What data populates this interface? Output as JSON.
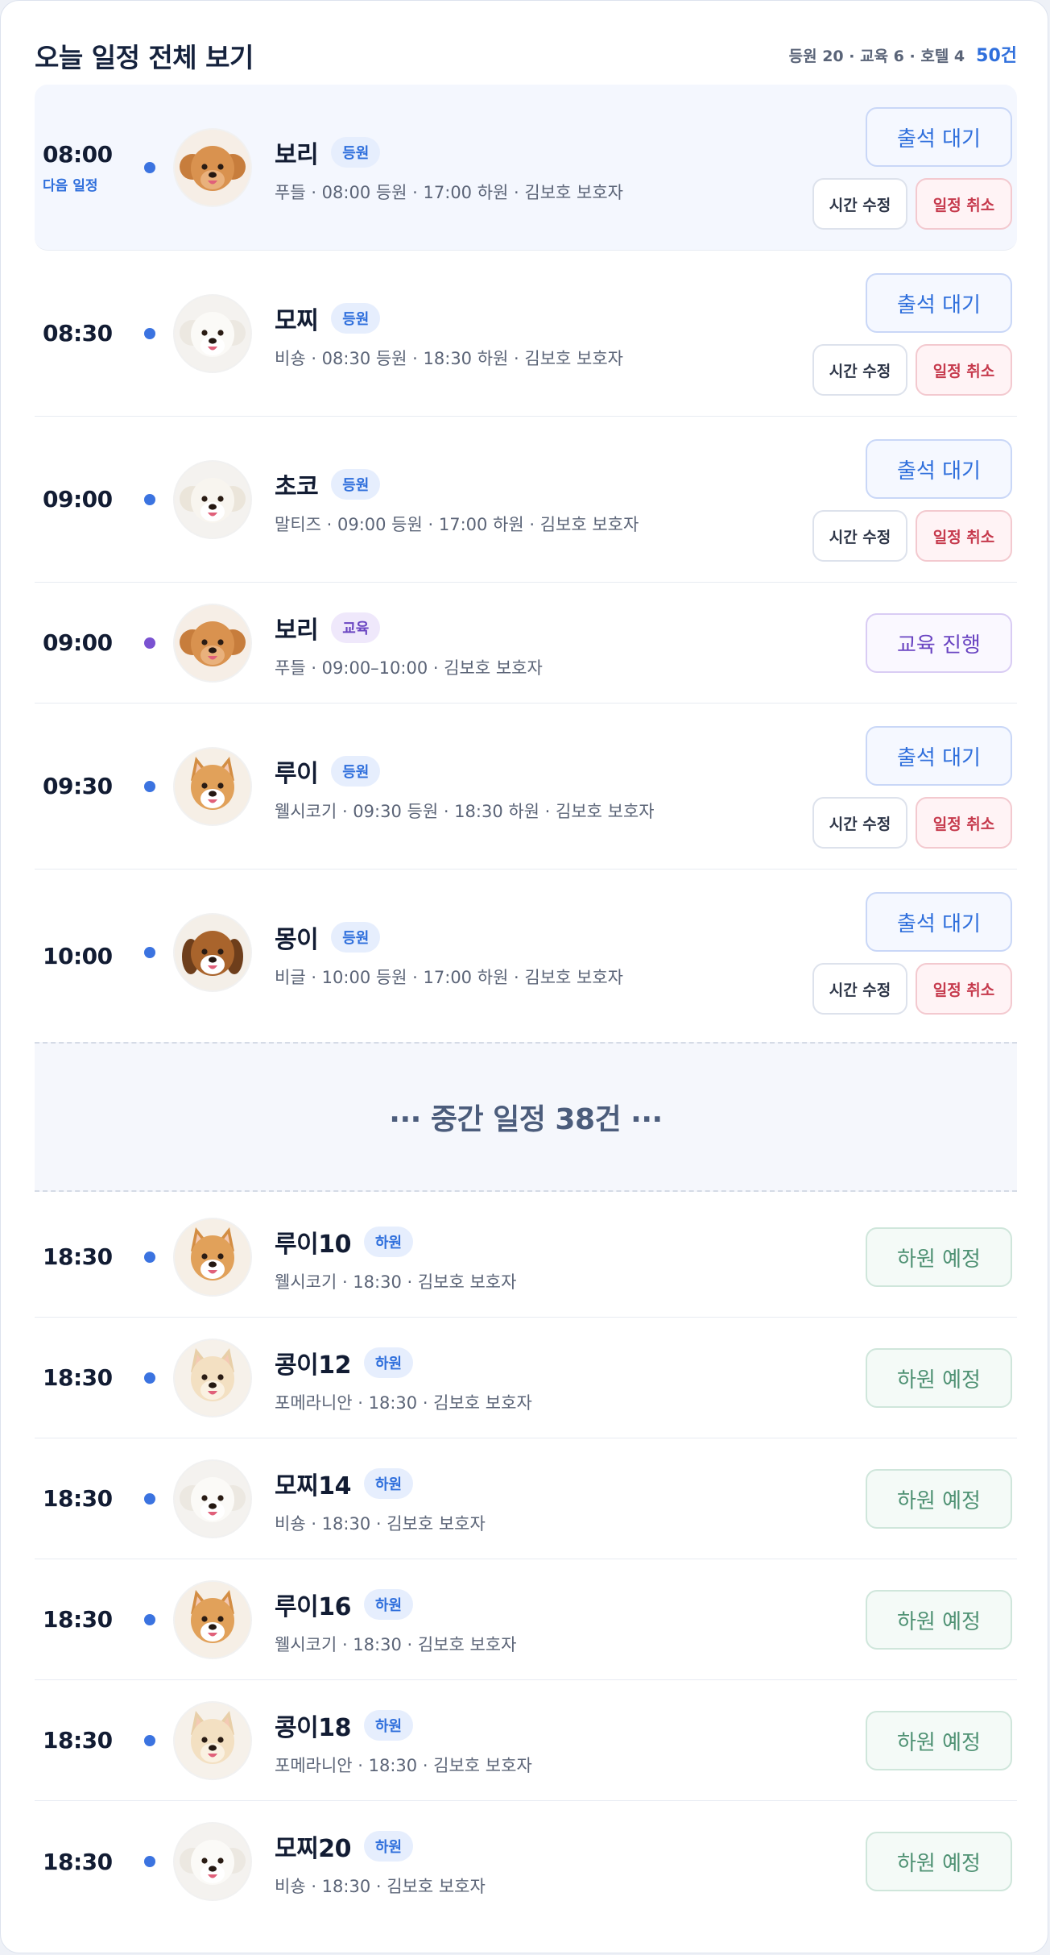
{
  "header": {
    "title": "오늘 일정 전체 보기",
    "summary": "등원 20 · 교육 6 · 호텔 4",
    "total": "50건"
  },
  "next_label": "다음 일정",
  "actions": {
    "edit_time": "시간 수정",
    "cancel": "일정 취소"
  },
  "rows_top": [
    {
      "time": "08:00",
      "name": "보리",
      "badge": "등원",
      "meta": "푸들 · 08:00 등원 · 17:00 하원 · 김보호 보호자",
      "action": "출석 대기",
      "breed": "poodle"
    },
    {
      "time": "08:30",
      "name": "모찌",
      "badge": "등원",
      "meta": "비숑 · 08:30 등원 · 18:30 하원 · 김보호 보호자",
      "action": "출석 대기",
      "breed": "bichon"
    },
    {
      "time": "09:00",
      "name": "초코",
      "badge": "등원",
      "meta": "말티즈 · 09:00 등원 · 17:00 하원 · 김보호 보호자",
      "action": "출석 대기",
      "breed": "maltese"
    },
    {
      "time": "09:00",
      "name": "보리",
      "badge": "교육",
      "meta": "푸들 · 09:00–10:00 · 김보호 보호자",
      "action": "교육 진행",
      "breed": "poodle"
    },
    {
      "time": "09:30",
      "name": "루이",
      "badge": "등원",
      "meta": "웰시코기 · 09:30 등원 · 18:30 하원 · 김보호 보호자",
      "action": "출석 대기",
      "breed": "corgi"
    },
    {
      "time": "10:00",
      "name": "몽이",
      "badge": "등원",
      "meta": "비글 · 10:00 등원 · 17:00 하원 · 김보호 보호자",
      "action": "출석 대기",
      "breed": "beagle"
    }
  ],
  "gap_label": "··· 중간 일정 38건 ···",
  "rows_bottom": [
    {
      "time": "18:30",
      "name": "루이10",
      "badge": "하원",
      "meta": "웰시코기 · 18:30 · 김보호 보호자",
      "action": "하원 예정",
      "breed": "corgi"
    },
    {
      "time": "18:30",
      "name": "콩이12",
      "badge": "하원",
      "meta": "포메라니안 · 18:30 · 김보호 보호자",
      "action": "하원 예정",
      "breed": "pomeranian"
    },
    {
      "time": "18:30",
      "name": "모찌14",
      "badge": "하원",
      "meta": "비숑 · 18:30 · 김보호 보호자",
      "action": "하원 예정",
      "breed": "bichon"
    },
    {
      "time": "18:30",
      "name": "루이16",
      "badge": "하원",
      "meta": "웰시코기 · 18:30 · 김보호 보호자",
      "action": "하원 예정",
      "breed": "corgi"
    },
    {
      "time": "18:30",
      "name": "콩이18",
      "badge": "하원",
      "meta": "포메라니안 · 18:30 · 김보호 보호자",
      "action": "하원 예정",
      "breed": "pomeranian"
    },
    {
      "time": "18:30",
      "name": "모찌20",
      "badge": "하원",
      "meta": "비숑 · 18:30 · 김보호 보호자",
      "action": "하원 예정",
      "breed": "bichon"
    }
  ],
  "colors": {
    "accent": "#2f6fdc",
    "education": "#6a45c2",
    "cancel": "#c63a4d",
    "leave": "#4e9173"
  }
}
